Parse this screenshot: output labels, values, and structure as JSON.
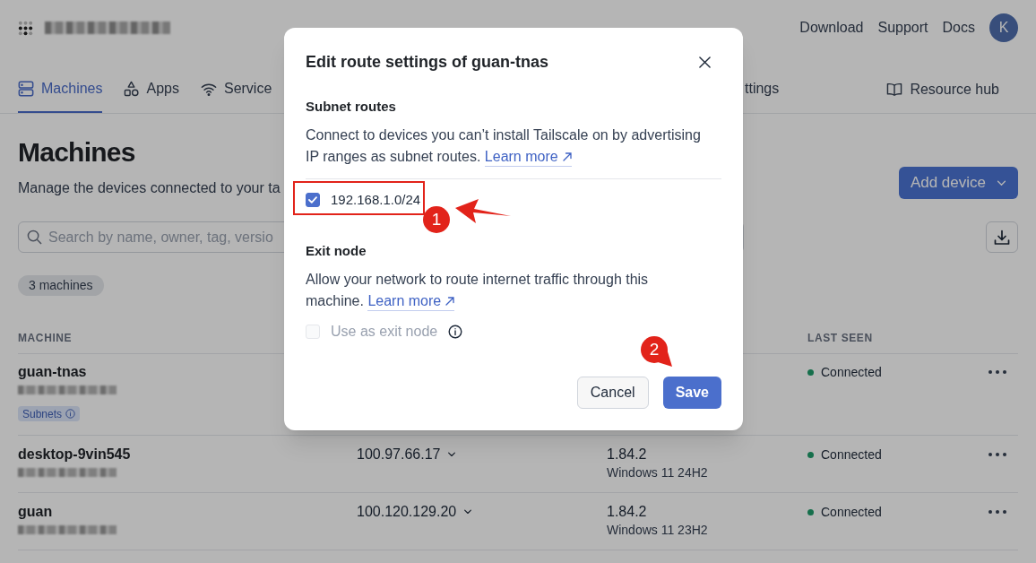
{
  "header": {
    "links": [
      "Download",
      "Support",
      "Docs"
    ],
    "avatar": {
      "initial": "K"
    }
  },
  "nav": {
    "tabs": [
      {
        "label": "Machines",
        "selected": true
      },
      {
        "label": "Apps",
        "selected": false
      },
      {
        "label": "Service",
        "selected": false
      }
    ],
    "covered_tab": {
      "label": "ttings",
      "selected": false
    },
    "resource_link": "Resource hub"
  },
  "page": {
    "title": "Machines",
    "subtitle": "Manage the devices connected to your ta",
    "add_button": "Add device",
    "search": {
      "placeholder": "Search by name, owner, tag, versio"
    },
    "count": "3 machines"
  },
  "table": {
    "columns": {
      "machine": "MACHINE",
      "last_seen": "LAST SEEN"
    },
    "rows": [
      {
        "name": "guan-tnas",
        "badge": "Subnets",
        "status": "Connected",
        "online": true
      },
      {
        "name": "desktop-9vin545",
        "address": "100.97.66.17",
        "version": "1.84.2",
        "os": "Windows 11 24H2",
        "status": "Connected",
        "online": true
      },
      {
        "name": "guan",
        "address": "100.120.129.20",
        "version": "1.84.2",
        "os": "Windows 11 23H2",
        "status": "Connected",
        "online": true
      }
    ]
  },
  "dialog": {
    "title": "Edit route settings of guan-tnas",
    "subnet": {
      "heading": "Subnet routes",
      "description": "Connect to devices you can’t install Tailscale on by advertising IP ranges as subnet routes.",
      "link": "Learn more",
      "routes": [
        {
          "label": "192.168.1.0/24",
          "checked": true
        }
      ]
    },
    "exit_node": {
      "heading": "Exit node",
      "description": "Allow your network to route internet traffic through this machine.",
      "link": "Learn more",
      "option": {
        "label": "Use as exit node",
        "checked": false,
        "disabled": true
      }
    },
    "buttons": [
      {
        "label": "Cancel",
        "kind": "secondary"
      },
      {
        "label": "Save",
        "kind": "primary"
      }
    ]
  },
  "annotations": [
    {
      "kind": "frame_arrow",
      "number": "1"
    },
    {
      "kind": "pointer",
      "number": "2"
    }
  ]
}
